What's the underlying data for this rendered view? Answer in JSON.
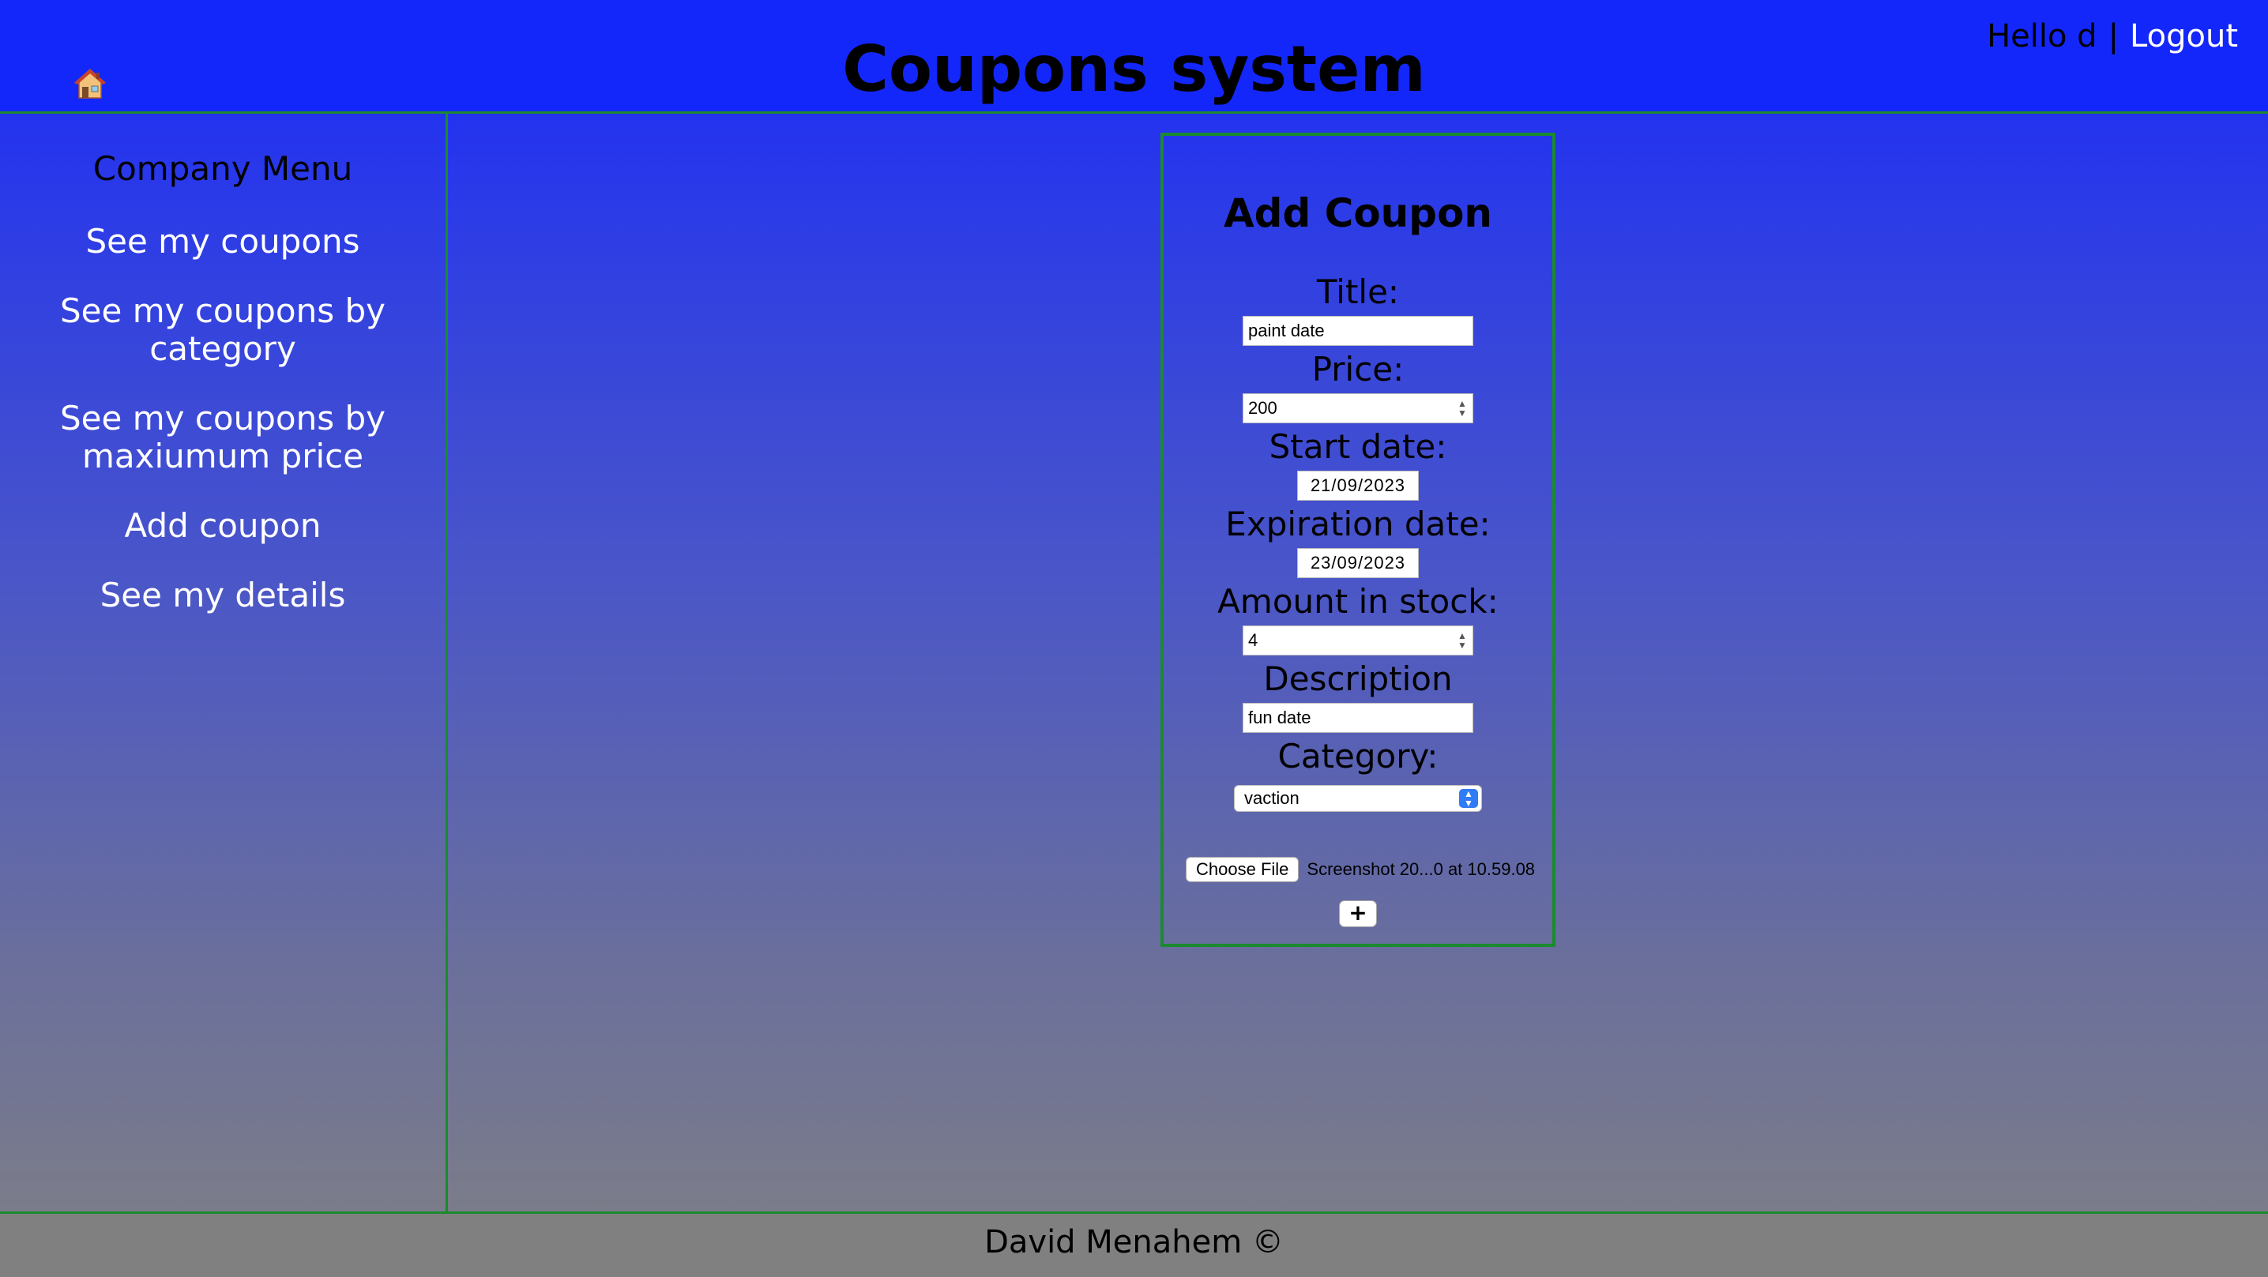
{
  "header": {
    "title": "Coupons system",
    "home_icon": "home-icon",
    "greeting": "Hello d",
    "separator": "|",
    "logout_label": "Logout"
  },
  "sidebar": {
    "title": "Company Menu",
    "items": [
      {
        "label": "See my coupons"
      },
      {
        "label": "See my coupons by category"
      },
      {
        "label": "See my coupons by maxiumum price"
      },
      {
        "label": "Add coupon"
      },
      {
        "label": "See my details"
      }
    ]
  },
  "form": {
    "heading": "Add Coupon",
    "title_label": "Title:",
    "title_value": "paint date",
    "price_label": "Price:",
    "price_value": "200",
    "start_label": "Start date:",
    "start_value": "21/09/2023",
    "expiration_label": "Expiration date:",
    "expiration_value": "23/09/2023",
    "amount_label": "Amount in stock:",
    "amount_value": "4",
    "description_label": "Description",
    "description_value": "fun date",
    "category_label": "Category:",
    "category_value": "vaction",
    "file_button_label": "Choose File",
    "file_name": "Screenshot 20...0 at 10.59.08",
    "submit_label": "+"
  },
  "footer": {
    "text": "David Menahem ©"
  },
  "colors": {
    "header_bg": "#1327fb",
    "border": "#1b8a2e",
    "footer_bg": "#808080",
    "link": "#ffffff"
  }
}
